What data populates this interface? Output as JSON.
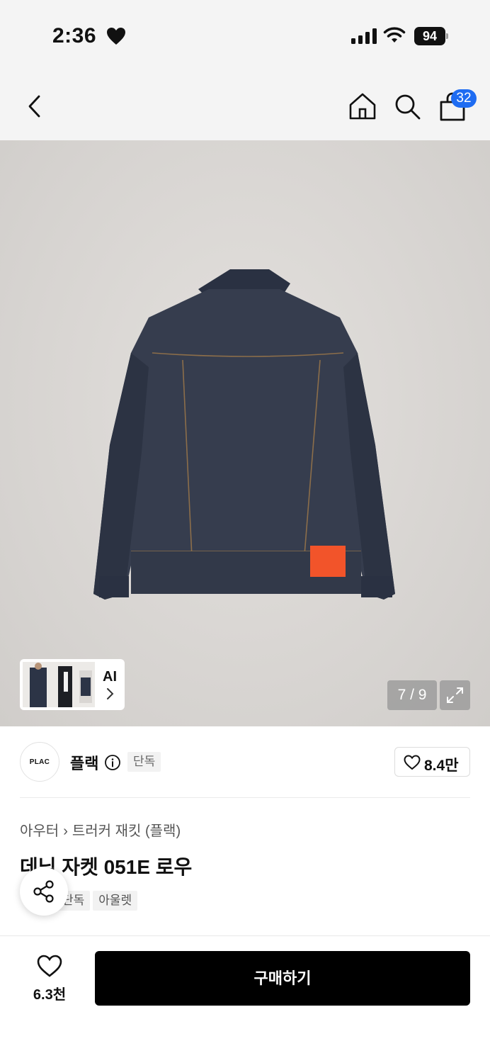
{
  "status_bar": {
    "time": "2:36",
    "battery": "94"
  },
  "header": {
    "cart_count": "32"
  },
  "gallery": {
    "ai_label": "AI",
    "page_indicator": "7 / 9"
  },
  "brand": {
    "logo_text": "PLAC",
    "name": "플랙",
    "exclusive_tag": "단독",
    "like_count": "8.4만"
  },
  "product": {
    "breadcrumb": [
      "아우터",
      "트러커 재킷 (플랙)"
    ],
    "title": "데님 자켓 051E 로우",
    "tags": [
      "단독",
      "아울렛"
    ]
  },
  "bottom_bar": {
    "wish_count": "6.3천",
    "buy_label": "구매하기"
  },
  "colors": {
    "accent_blue": "#1e6cf2",
    "buy_button": "#000000",
    "image_bg": "#d8d5d2",
    "denim": "#343b4c",
    "patch_orange": "#f2542a"
  },
  "icons": [
    "heart-icon",
    "signal-icon",
    "wifi-icon",
    "battery-icon",
    "back-chevron-icon",
    "home-icon",
    "search-icon",
    "shopping-bag-icon",
    "chevron-right-icon",
    "expand-icon",
    "info-icon",
    "share-icon"
  ]
}
